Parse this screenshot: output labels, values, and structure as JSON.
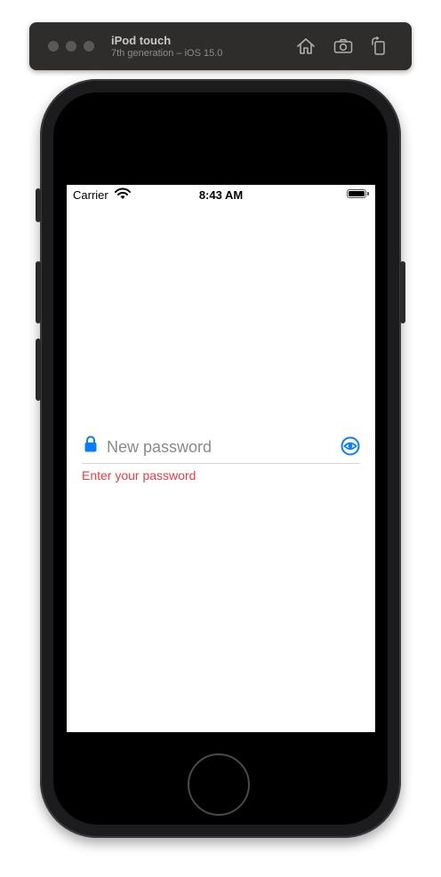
{
  "simulator": {
    "device_name": "iPod touch",
    "device_subtitle": "7th generation – iOS 15.0",
    "toolbar_icons": [
      "home-icon",
      "screenshot-icon",
      "rotate-icon"
    ]
  },
  "status_bar": {
    "carrier": "Carrier",
    "time": "8:43 AM",
    "icons": [
      "wifi-icon",
      "battery-icon"
    ]
  },
  "password_field": {
    "placeholder": "New password",
    "value": "",
    "leading_icon": "lock-icon",
    "trailing_icon": "eye-icon",
    "error_text": "Enter your password"
  },
  "colors": {
    "accent": "#0a7cff",
    "error": "#ef3b44",
    "placeholder": "#8a8a8e",
    "toolbar_bg": "#2f2d2c"
  }
}
